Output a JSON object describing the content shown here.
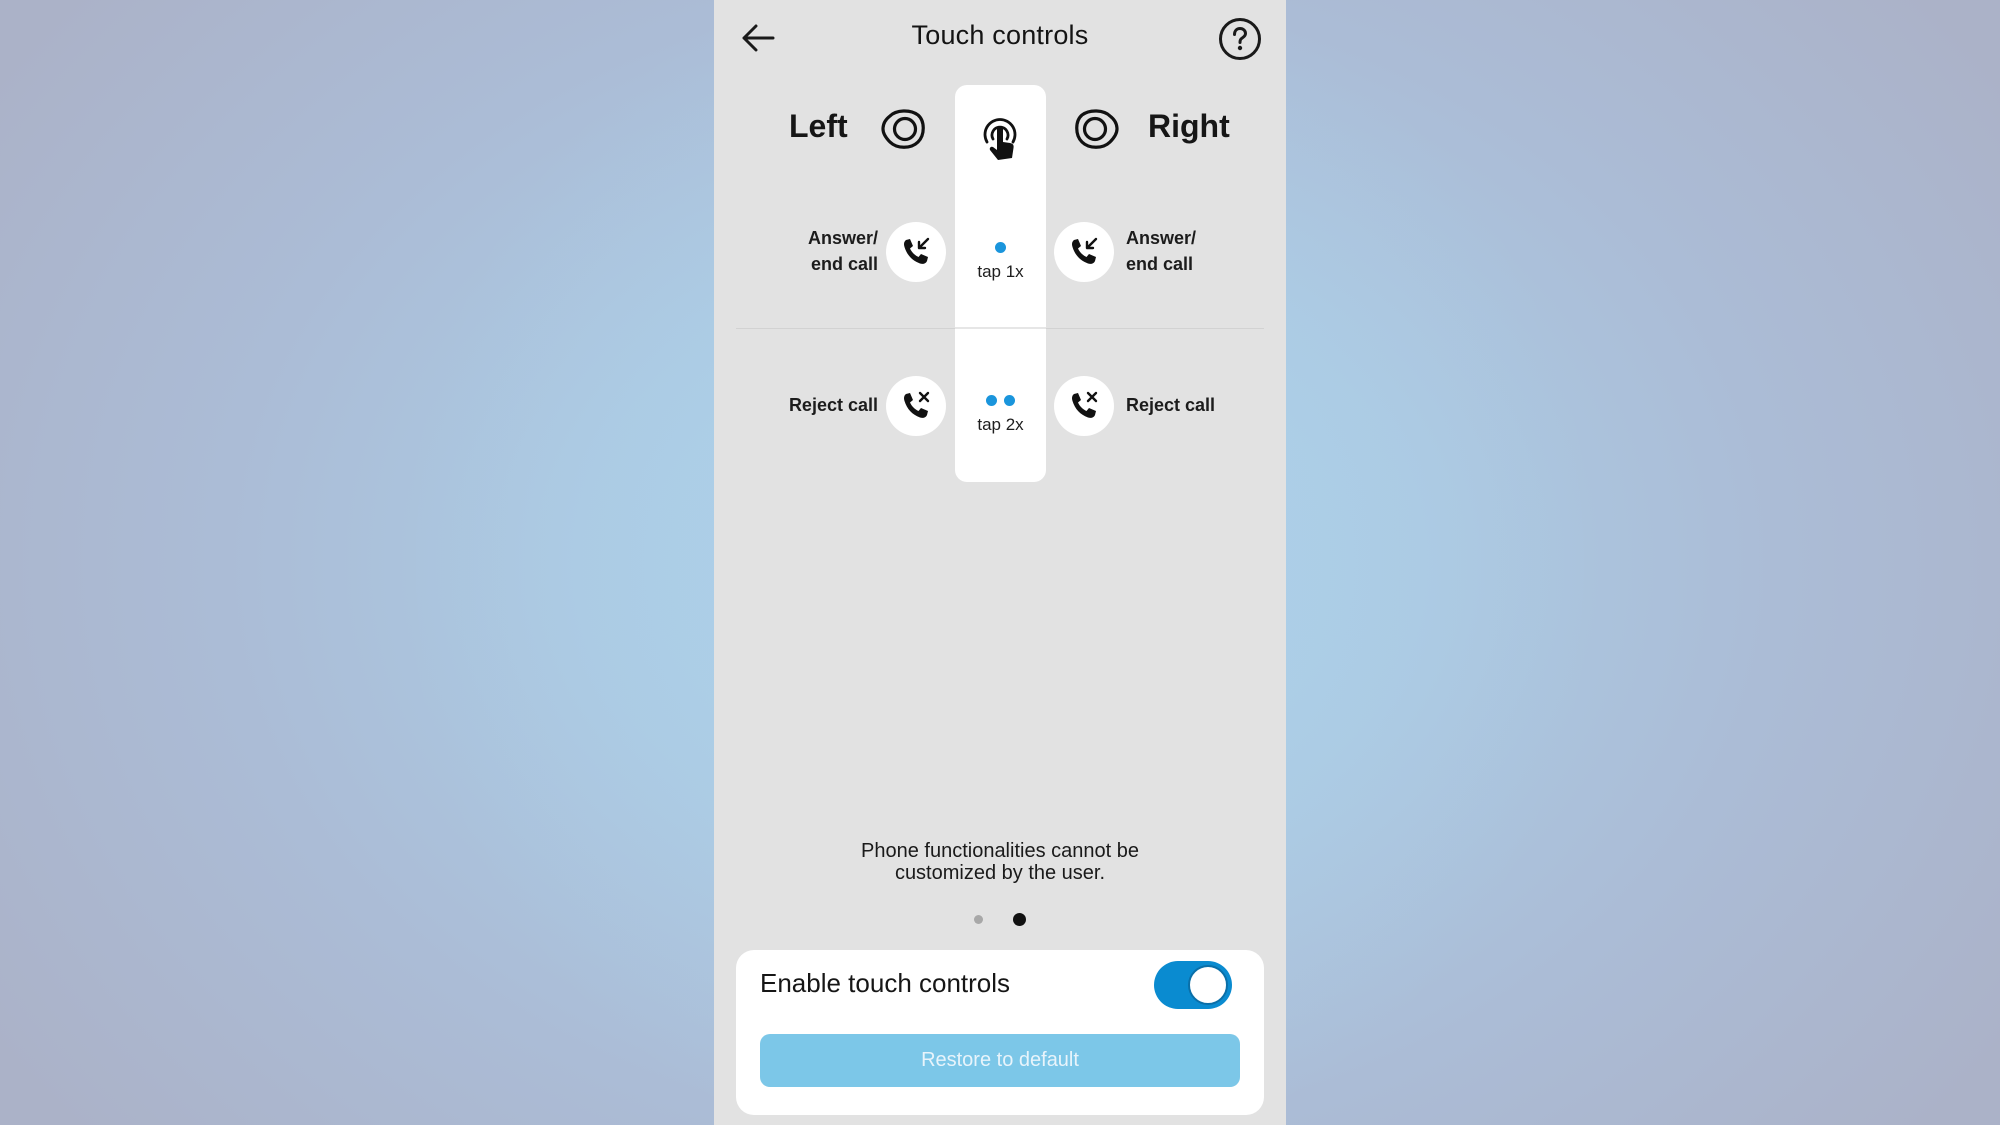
{
  "header": {
    "title": "Touch controls",
    "back_icon": "arrow-left-icon",
    "help_icon": "question-circle-icon"
  },
  "sides": {
    "left": {
      "label": "Left",
      "icon": "earbud-left-icon"
    },
    "right": {
      "label": "Right",
      "icon": "earbud-right-icon"
    },
    "center_icon": "touch-gesture-icon"
  },
  "gestures": [
    {
      "dots": 1,
      "label": "tap 1x",
      "left": {
        "label_line1": "Answer/",
        "label_line2": "end call",
        "icon": "phone-incoming-icon"
      },
      "right": {
        "label_line1": "Answer/",
        "label_line2": "end call",
        "icon": "phone-incoming-icon"
      }
    },
    {
      "dots": 2,
      "label": "tap 2x",
      "left": {
        "label_line1": "Reject call",
        "label_line2": "",
        "icon": "phone-reject-icon"
      },
      "right": {
        "label_line1": "Reject call",
        "label_line2": "",
        "icon": "phone-reject-icon"
      }
    }
  ],
  "info": {
    "line1": "Phone functionalities cannot be",
    "line2": "customized by the user."
  },
  "pager": {
    "total": 2,
    "current": 2
  },
  "settings": {
    "toggle_label": "Enable touch controls",
    "toggle_on": true,
    "restore_label": "Restore to default"
  },
  "colors": {
    "accent": "#0a8bd0",
    "gesture_dot": "#1a95dc",
    "restore_button": "#7cc7e8",
    "panel_bg": "#e2e2e2"
  }
}
